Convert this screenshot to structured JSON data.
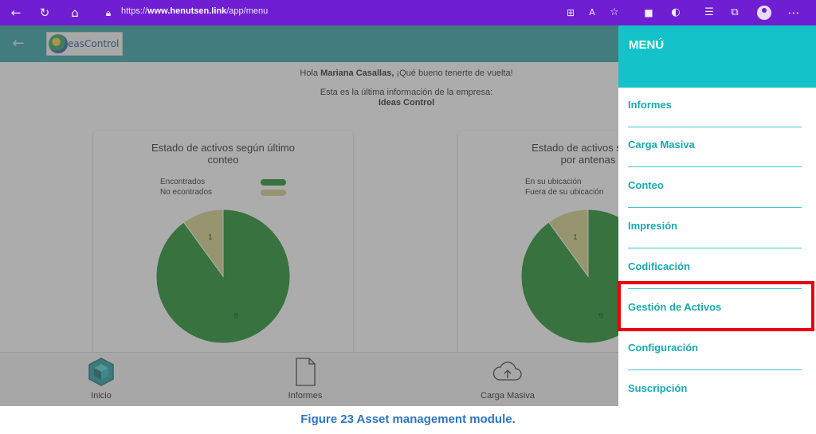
{
  "browser": {
    "url_prefix": "https://",
    "url_domain": "www.henutsen.link",
    "url_path": "/app/menu"
  },
  "header": {
    "logo_text": "easControl"
  },
  "greeting": {
    "hello": "Hola ",
    "user": "Mariana Casallas,",
    "rest": " ¡Qué bueno tenerte de vuelta!",
    "intro": "Esta es la última información de la empresa:",
    "company": "Ideas Control"
  },
  "cards": [
    {
      "title_line1": "Estado de activos según último",
      "title_line2": "conteo",
      "legend": [
        {
          "label": "Encontrados",
          "color": "#148a25"
        },
        {
          "label": "No econtrados",
          "color": "#d4cf86"
        }
      ]
    },
    {
      "title_line1": "Estado de activos según",
      "title_line2": "por antenas",
      "legend": [
        {
          "label": "En su ubicación",
          "color": "#148a25"
        },
        {
          "label": "Fuera de su ubicación",
          "color": "#d4cf86"
        }
      ]
    }
  ],
  "chart_data": [
    {
      "type": "pie",
      "labels": [
        "Encontrados",
        "No econtrados"
      ],
      "values": [
        9,
        1
      ],
      "colors": [
        "#148a25",
        "#d4cf86"
      ]
    },
    {
      "type": "pie",
      "labels": [
        "En su ubicación",
        "Fuera de su ubicación"
      ],
      "values": [
        9,
        1
      ],
      "colors": [
        "#148a25",
        "#d4cf86"
      ]
    }
  ],
  "bottom_nav": [
    {
      "label": "Inicio",
      "icon": "cube-icon"
    },
    {
      "label": "Informes",
      "icon": "document-icon"
    },
    {
      "label": "Carga Masiva",
      "icon": "cloud-upload-icon"
    }
  ],
  "menu": {
    "title": "MENÚ",
    "items": [
      "Informes",
      "Carga Masiva",
      "Conteo",
      "Impresión",
      "Codificación",
      "Gestión de Activos",
      "Configuración",
      "Suscripción"
    ],
    "highlighted": "Gestión de Activos"
  },
  "caption": "Figure 23 Asset management module.",
  "colors": {
    "browser": "#6f1fd1",
    "header": "#2a9ea2",
    "menu_header": "#14c3c9",
    "menu_text": "#1aa8b0",
    "highlight": "#e8000b"
  }
}
